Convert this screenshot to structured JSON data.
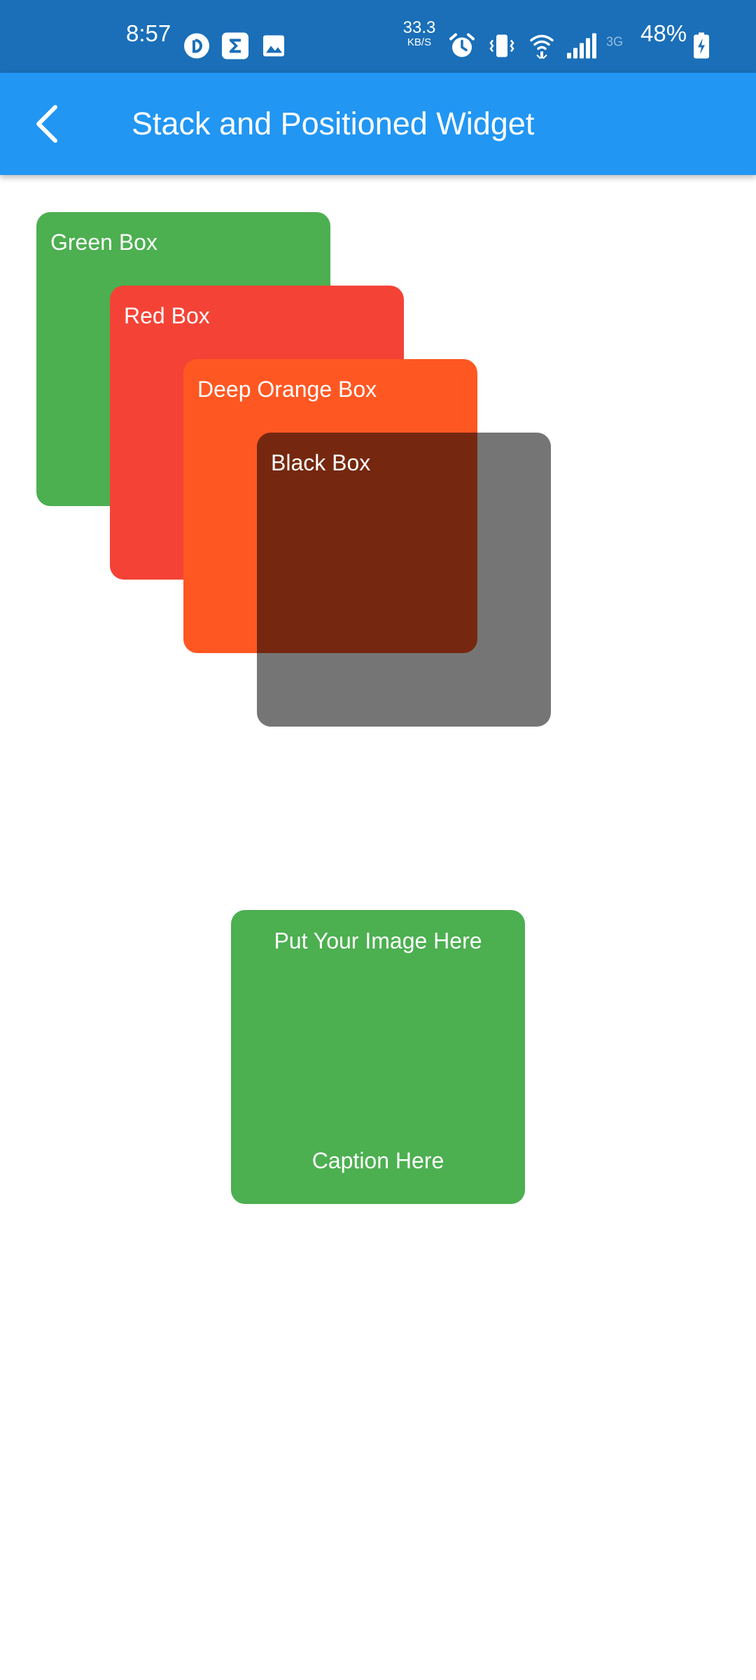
{
  "status_bar": {
    "time": "8:57",
    "net_speed_value": "33.3",
    "net_speed_unit": "KB/S",
    "network_type": "3G",
    "battery_percent": "48%",
    "icons": [
      "pocket-casts-icon",
      "sigma-icon",
      "gallery-icon",
      "alarm-icon",
      "vibrate-icon",
      "wifi-icon",
      "signal-icon",
      "no-data-icon",
      "battery-charging-icon"
    ],
    "background_color": "#1A6FB8"
  },
  "app_bar": {
    "title": "Stack and Positioned Widget",
    "back_icon": "back-arrow-icon",
    "background_color": "#2196F3"
  },
  "stack": {
    "boxes": [
      {
        "label": "Green Box",
        "color": "#4CAF50"
      },
      {
        "label": "Red Box",
        "color": "#F44336"
      },
      {
        "label": "Deep Orange Box",
        "color": "#FF5722"
      },
      {
        "label": "Black Box",
        "color": "rgba(0,0,0,0.54)"
      }
    ]
  },
  "image_card": {
    "title": "Put Your Image Here",
    "caption": "Caption Here",
    "color": "#4CAF50"
  }
}
